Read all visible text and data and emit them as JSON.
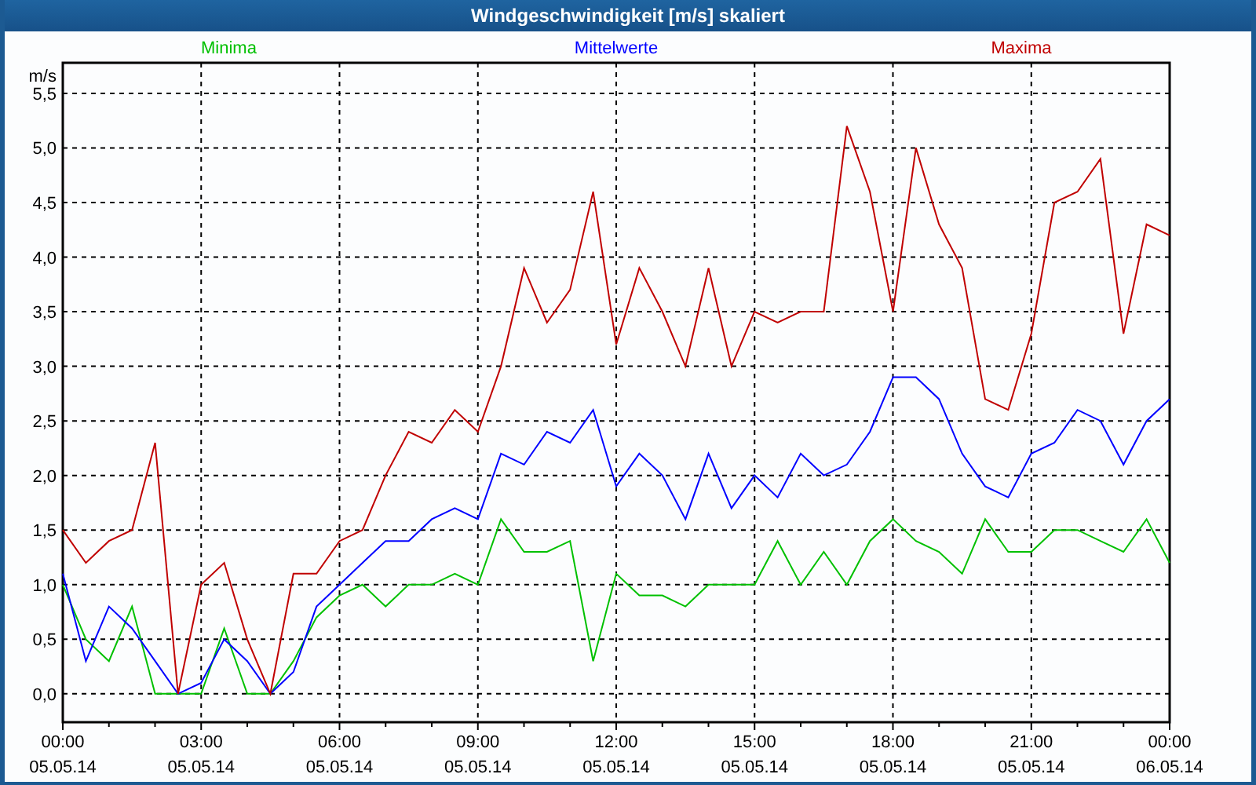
{
  "window": {
    "title": "Windgeschwindigkeit [m/s] skaliert"
  },
  "chart_data": {
    "type": "line",
    "ylabel": "m/s",
    "grid": true,
    "categories": [
      "00:00\n05.05.14",
      null,
      null,
      null,
      null,
      null,
      "03:00\n05.05.14",
      null,
      null,
      null,
      null,
      null,
      "06:00\n05.05.14",
      null,
      null,
      null,
      null,
      null,
      "09:00\n05.05.14",
      null,
      null,
      null,
      null,
      null,
      "12:00\n05.05.14",
      null,
      null,
      null,
      null,
      null,
      "15:00\n05.05.14",
      null,
      null,
      null,
      null,
      null,
      "18:00\n05.05.14",
      null,
      null,
      null,
      null,
      null,
      "21:00\n05.05.14",
      null,
      null,
      null,
      null,
      null,
      "00:00\n06.05.14"
    ],
    "series": [
      {
        "name": "Minima",
        "color": "#00c000",
        "values": [
          1.0,
          0.5,
          0.3,
          0.8,
          0.0,
          0.0,
          0.0,
          0.6,
          0.0,
          0.0,
          0.3,
          0.7,
          0.9,
          1.0,
          0.8,
          1.0,
          1.0,
          1.1,
          1.0,
          1.6,
          1.3,
          1.3,
          1.4,
          0.3,
          1.1,
          0.9,
          0.9,
          0.8,
          1.0,
          1.0,
          1.0,
          1.4,
          1.0,
          1.3,
          1.0,
          1.4,
          1.6,
          1.4,
          1.3,
          1.1,
          1.6,
          1.3,
          1.3,
          1.5,
          1.5,
          1.4,
          1.3,
          1.6,
          1.2
        ]
      },
      {
        "name": "Mittelwerte",
        "color": "#0000ff",
        "values": [
          1.1,
          0.3,
          0.8,
          0.6,
          0.3,
          0.0,
          0.1,
          0.5,
          0.3,
          0.0,
          0.2,
          0.8,
          1.0,
          1.2,
          1.4,
          1.4,
          1.6,
          1.7,
          1.6,
          2.2,
          2.1,
          2.4,
          2.3,
          2.6,
          1.9,
          2.2,
          2.0,
          1.6,
          2.2,
          1.7,
          2.0,
          1.8,
          2.2,
          2.0,
          2.1,
          2.4,
          2.9,
          2.9,
          2.7,
          2.2,
          1.9,
          1.8,
          2.2,
          2.3,
          2.6,
          2.5,
          2.1,
          2.5,
          2.7
        ]
      },
      {
        "name": "Maxima",
        "color": "#c00000",
        "values": [
          1.5,
          1.2,
          1.4,
          1.5,
          2.3,
          0.0,
          1.0,
          1.2,
          0.5,
          0.0,
          1.1,
          1.1,
          1.4,
          1.5,
          2.0,
          2.4,
          2.3,
          2.6,
          2.4,
          3.0,
          3.9,
          3.4,
          3.7,
          4.6,
          3.2,
          3.9,
          3.5,
          3.0,
          3.9,
          3.0,
          3.5,
          3.4,
          3.5,
          3.5,
          5.2,
          4.6,
          3.5,
          5.0,
          4.3,
          3.9,
          2.7,
          2.6,
          3.3,
          4.5,
          4.6,
          4.9,
          3.3,
          4.3,
          4.2
        ]
      }
    ],
    "ylim": [
      -0.26,
      5.78
    ],
    "yticks": [
      {
        "value": 0,
        "label": "0,0"
      },
      {
        "value": 0.5,
        "label": "0,5"
      },
      {
        "value": 1,
        "label": "1,0"
      },
      {
        "value": 1.5,
        "label": "1,5"
      },
      {
        "value": 2,
        "label": "2,0"
      },
      {
        "value": 2.5,
        "label": "2,5"
      },
      {
        "value": 3,
        "label": "3,0"
      },
      {
        "value": 3.5,
        "label": "3,5"
      },
      {
        "value": 4,
        "label": "4,0"
      },
      {
        "value": 4.5,
        "label": "4,5"
      },
      {
        "value": 5,
        "label": "5,0"
      },
      {
        "value": 5.5,
        "label": "5,5"
      }
    ]
  }
}
